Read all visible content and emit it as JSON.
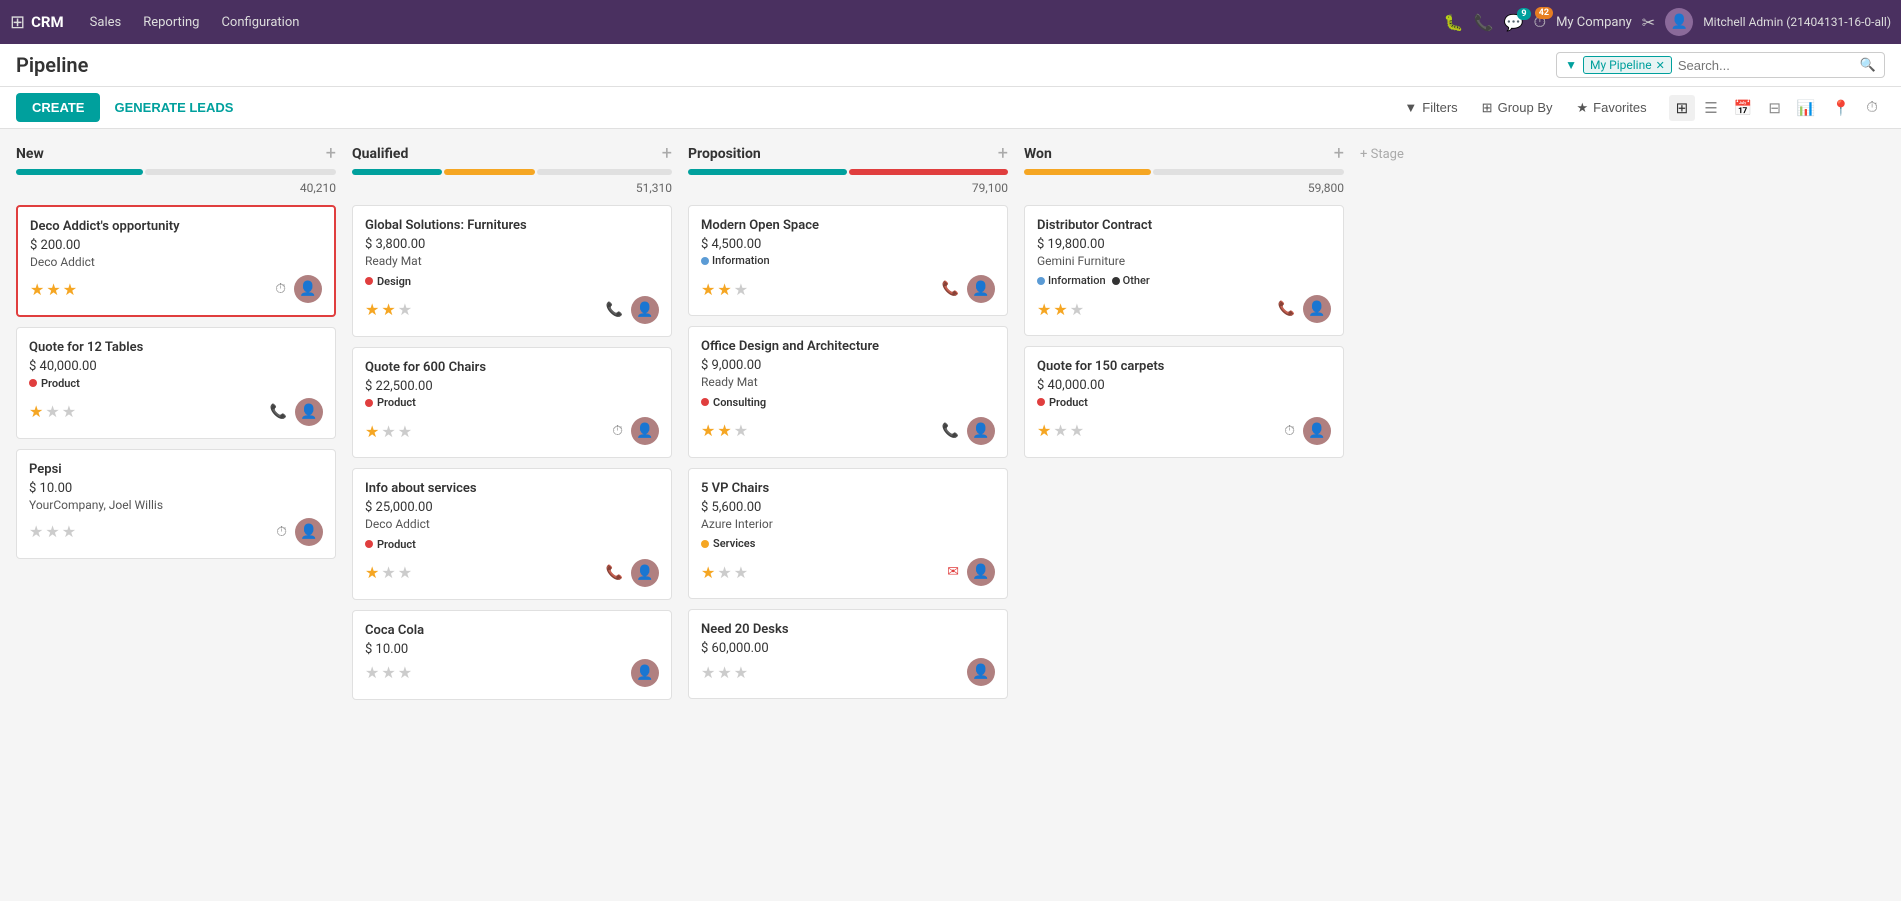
{
  "app": {
    "name": "CRM",
    "nav": [
      "Sales",
      "Reporting",
      "Configuration"
    ]
  },
  "topbar": {
    "icons": [
      "bug-icon",
      "phone-icon",
      "chat-icon",
      "clock-icon"
    ],
    "chat_badge": "9",
    "clock_badge": "42",
    "company": "My Company",
    "username": "Mitchell Admin (21404131-16-0-all)"
  },
  "header": {
    "title": "Pipeline",
    "create_btn": "CREATE",
    "generate_btn": "GENERATE LEADS"
  },
  "search": {
    "filter_label": "My Pipeline",
    "placeholder": "Search..."
  },
  "toolbar": {
    "filters": "Filters",
    "group_by": "Group By",
    "favorites": "Favorites"
  },
  "stages": [
    {
      "name": "New",
      "total": "40,210",
      "bar": [
        {
          "color": "#00a09d",
          "flex": 2
        },
        {
          "color": "#e0e0e0",
          "flex": 3
        }
      ],
      "cards": [
        {
          "id": "deco-addict-opp",
          "title": "Deco Addict's opportunity",
          "amount": "$ 200.00",
          "company": "Deco Addict",
          "tag": null,
          "stars": 3,
          "actions": [
            "clock"
          ],
          "selected": true
        },
        {
          "id": "quote-12-tables",
          "title": "Quote for 12 Tables",
          "amount": "$ 40,000.00",
          "company": null,
          "tag": {
            "label": "Product",
            "color": "#e03e3e"
          },
          "stars": 1,
          "actions": [
            "phone"
          ]
        },
        {
          "id": "pepsi",
          "title": "Pepsi",
          "amount": "$ 10.00",
          "company": "YourCompany, Joel Willis",
          "tag": null,
          "stars": 0,
          "actions": [
            "clock"
          ]
        }
      ]
    },
    {
      "name": "Qualified",
      "total": "51,310",
      "bar": [
        {
          "color": "#00a09d",
          "flex": 2
        },
        {
          "color": "#f5a623",
          "flex": 2
        },
        {
          "color": "#e0e0e0",
          "flex": 3
        }
      ],
      "cards": [
        {
          "id": "global-solutions",
          "title": "Global Solutions: Furnitures",
          "amount": "$ 3,800.00",
          "company": "Ready Mat",
          "tag": {
            "label": "Design",
            "color": "#e03e3e"
          },
          "stars": 2,
          "actions": [
            "phone"
          ]
        },
        {
          "id": "quote-600-chairs",
          "title": "Quote for 600 Chairs",
          "amount": "$ 22,500.00",
          "company": null,
          "tag": {
            "label": "Product",
            "color": "#e03e3e"
          },
          "stars": 1,
          "actions": [
            "clock"
          ]
        },
        {
          "id": "info-about-services",
          "title": "Info about services",
          "amount": "$ 25,000.00",
          "company": "Deco Addict",
          "tag": {
            "label": "Product",
            "color": "#e03e3e"
          },
          "stars": 1,
          "actions": [
            "phone-orange"
          ]
        },
        {
          "id": "coca-cola",
          "title": "Coca Cola",
          "amount": "$ 10.00",
          "company": null,
          "tag": null,
          "stars": 0,
          "actions": []
        }
      ]
    },
    {
      "name": "Proposition",
      "total": "79,100",
      "bar": [
        {
          "color": "#00a09d",
          "flex": 3
        },
        {
          "color": "#e03e3e",
          "flex": 3
        }
      ],
      "cards": [
        {
          "id": "modern-open-space",
          "title": "Modern Open Space",
          "amount": "$ 4,500.00",
          "company": null,
          "info_tags": [
            {
              "label": "Information",
              "color": "#5b9bd5"
            }
          ],
          "stars": 2,
          "actions": [
            "phone-orange"
          ]
        },
        {
          "id": "office-design-arch",
          "title": "Office Design and Architecture",
          "amount": "$ 9,000.00",
          "company": "Ready Mat",
          "tag": {
            "label": "Consulting",
            "color": "#e03e3e"
          },
          "stars": 2,
          "actions": [
            "phone"
          ]
        },
        {
          "id": "5-vp-chairs",
          "title": "5 VP Chairs",
          "amount": "$ 5,600.00",
          "company": "Azure Interior",
          "tag": {
            "label": "Services",
            "color": "#f5a623"
          },
          "stars": 1,
          "actions": [
            "email"
          ]
        },
        {
          "id": "need-20-desks",
          "title": "Need 20 Desks",
          "amount": "$ 60,000.00",
          "company": null,
          "tag": null,
          "stars": 0,
          "actions": []
        }
      ]
    },
    {
      "name": "Won",
      "total": "59,800",
      "bar": [
        {
          "color": "#f5a623",
          "flex": 2
        },
        {
          "color": "#e0e0e0",
          "flex": 3
        }
      ],
      "cards": [
        {
          "id": "distributor-contract",
          "title": "Distributor Contract",
          "amount": "$ 19,800.00",
          "company": "Gemini Furniture",
          "info_tags": [
            {
              "label": "Information",
              "color": "#5b9bd5"
            },
            {
              "label": "Other",
              "color": "#333"
            }
          ],
          "stars": 2,
          "actions": [
            "phone-orange"
          ]
        },
        {
          "id": "quote-150-carpets",
          "title": "Quote for 150 carpets",
          "amount": "$ 40,000.00",
          "company": null,
          "tag": {
            "label": "Product",
            "color": "#e03e3e"
          },
          "stars": 1,
          "actions": [
            "clock"
          ]
        }
      ]
    }
  ],
  "add_stage_label": "+ Stage"
}
